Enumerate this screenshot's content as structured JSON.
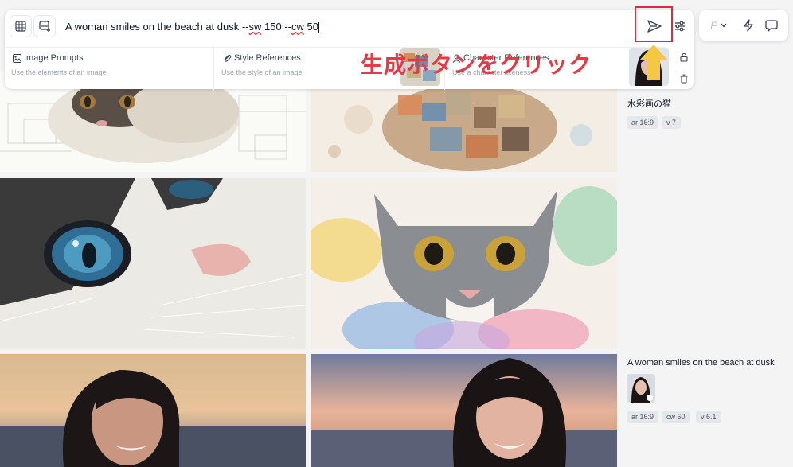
{
  "prompt": {
    "text_main": "A woman smiles on the beach at dusk --",
    "sw_param": "sw",
    "sw_value": " 150 --",
    "cw_param": "cw",
    "cw_value": " 50"
  },
  "references": {
    "image_prompts": {
      "title": "Image Prompts",
      "subtitle": "Use the elements of an image"
    },
    "style_references": {
      "title": "Style References",
      "subtitle": "Use the style of an image"
    },
    "character_references": {
      "title": "Character References",
      "subtitle": "Use a character likeness"
    }
  },
  "toolbar": {
    "personalize_label": "P"
  },
  "annotation": {
    "text": "生成ボタンをクリック"
  },
  "history": [
    {
      "title": "水彩画の猫",
      "chips": [
        "ar 16:9",
        "v 7"
      ]
    },
    {
      "title": "A woman smiles on the beach at dusk",
      "chips": [
        "ar 16:9",
        "cw 50",
        "v 6.1"
      ]
    }
  ],
  "colors": {
    "highlight": "#e12c37",
    "annotation": "#e53943",
    "arrow": "#f5c842"
  }
}
